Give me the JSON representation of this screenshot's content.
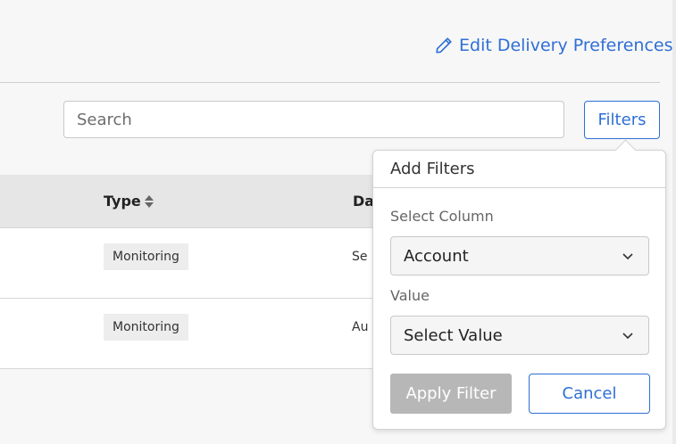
{
  "header": {
    "edit_link_label": "Edit Delivery Preferences",
    "edit_icon": "pencil-icon",
    "link_color": "#2f6fd6"
  },
  "toolbar": {
    "search_placeholder": "Search",
    "search_value": "",
    "filters_label": "Filters"
  },
  "table": {
    "columns": [
      {
        "label": "Type",
        "sortable": true
      },
      {
        "label": "Da",
        "sortable": false
      }
    ],
    "rows": [
      {
        "type": "Monitoring",
        "date": "Se"
      },
      {
        "type": "Monitoring",
        "date": "Au"
      }
    ]
  },
  "filter_panel": {
    "title": "Add Filters",
    "column_label": "Select Column",
    "column_value": "Account",
    "value_label": "Value",
    "value_placeholder": "Select Value",
    "apply_label": "Apply Filter",
    "apply_disabled": true,
    "cancel_label": "Cancel"
  }
}
